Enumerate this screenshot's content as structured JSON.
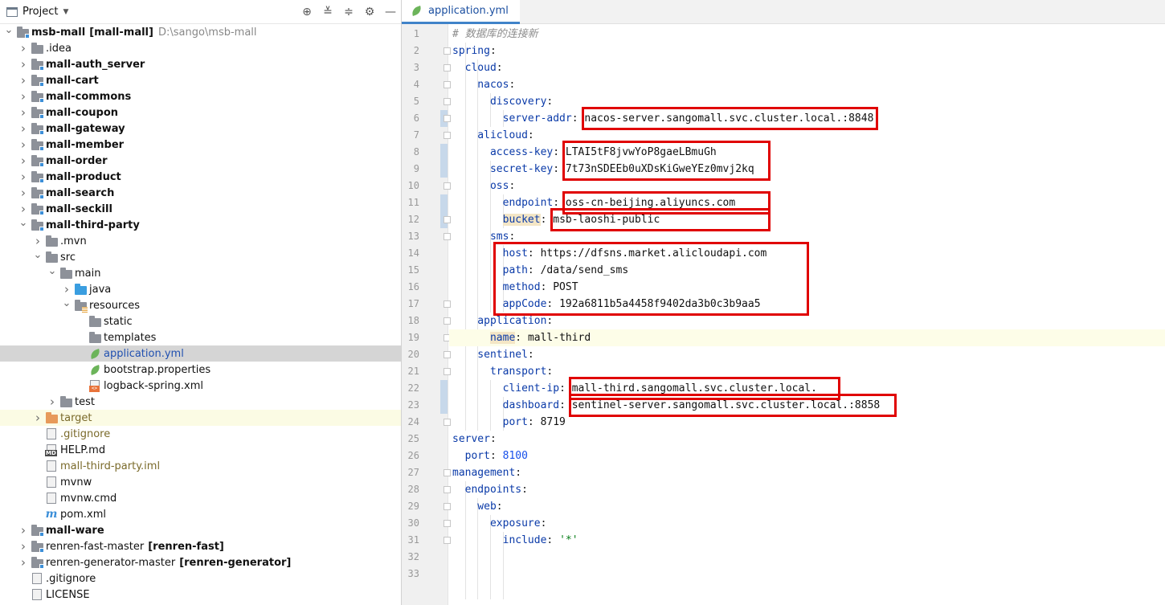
{
  "project_panel": {
    "title": "Project",
    "tools": [
      "locate-icon",
      "expand-all-icon",
      "collapse-all-icon",
      "gear-icon",
      "minimize-icon"
    ],
    "tree": [
      {
        "label": "msb-mall",
        "suffix": "[mall-mall]",
        "path": "D:\\sango\\msb-mall",
        "depth": 0,
        "expanded": true,
        "icon": "module-folder-icon"
      },
      {
        "label": ".idea",
        "depth": 1,
        "expanded": false,
        "icon": "folder-icon"
      },
      {
        "label": "mall-auth_server",
        "depth": 1,
        "expanded": false,
        "icon": "module-folder-icon"
      },
      {
        "label": "mall-cart",
        "depth": 1,
        "expanded": false,
        "icon": "module-folder-icon"
      },
      {
        "label": "mall-commons",
        "depth": 1,
        "expanded": false,
        "icon": "module-folder-icon"
      },
      {
        "label": "mall-coupon",
        "depth": 1,
        "expanded": false,
        "icon": "module-folder-icon"
      },
      {
        "label": "mall-gateway",
        "depth": 1,
        "expanded": false,
        "icon": "module-folder-icon"
      },
      {
        "label": "mall-member",
        "depth": 1,
        "expanded": false,
        "icon": "module-folder-icon"
      },
      {
        "label": "mall-order",
        "depth": 1,
        "expanded": false,
        "icon": "module-folder-icon"
      },
      {
        "label": "mall-product",
        "depth": 1,
        "expanded": false,
        "icon": "module-folder-icon"
      },
      {
        "label": "mall-search",
        "depth": 1,
        "expanded": false,
        "icon": "module-folder-icon"
      },
      {
        "label": "mall-seckill",
        "depth": 1,
        "expanded": false,
        "icon": "module-folder-icon"
      },
      {
        "label": "mall-third-party",
        "depth": 1,
        "expanded": true,
        "icon": "module-folder-icon"
      },
      {
        "label": ".mvn",
        "depth": 2,
        "expanded": false,
        "icon": "folder-icon"
      },
      {
        "label": "src",
        "depth": 2,
        "expanded": true,
        "icon": "folder-icon"
      },
      {
        "label": "main",
        "depth": 3,
        "expanded": true,
        "icon": "folder-icon"
      },
      {
        "label": "java",
        "depth": 4,
        "expanded": false,
        "icon": "source-folder-icon"
      },
      {
        "label": "resources",
        "depth": 4,
        "expanded": true,
        "icon": "resources-folder-icon"
      },
      {
        "label": "static",
        "depth": 5,
        "icon": "folder-icon"
      },
      {
        "label": "templates",
        "depth": 5,
        "icon": "folder-icon"
      },
      {
        "label": "application.yml",
        "depth": 5,
        "icon": "yaml-file-icon",
        "selected": true
      },
      {
        "label": "bootstrap.properties",
        "depth": 5,
        "icon": "properties-file-icon"
      },
      {
        "label": "logback-spring.xml",
        "depth": 5,
        "icon": "xml-file-icon"
      },
      {
        "label": "test",
        "depth": 3,
        "expanded": false,
        "icon": "folder-icon"
      },
      {
        "label": "target",
        "depth": 2,
        "expanded": false,
        "icon": "excluded-folder-icon",
        "excluded": true
      },
      {
        "label": ".gitignore",
        "depth": 2,
        "icon": "gitignore-file-icon"
      },
      {
        "label": "HELP.md",
        "depth": 2,
        "icon": "markdown-file-icon"
      },
      {
        "label": "mall-third-party.iml",
        "depth": 2,
        "icon": "iml-file-icon"
      },
      {
        "label": "mvnw",
        "depth": 2,
        "icon": "script-file-icon"
      },
      {
        "label": "mvnw.cmd",
        "depth": 2,
        "icon": "cmd-file-icon"
      },
      {
        "label": "pom.xml",
        "depth": 2,
        "icon": "maven-pom-icon"
      },
      {
        "label": "mall-ware",
        "depth": 1,
        "expanded": false,
        "icon": "module-folder-icon"
      },
      {
        "label": "renren-fast-master",
        "suffix": "[renren-fast]",
        "depth": 1,
        "expanded": false,
        "icon": "module-folder-icon"
      },
      {
        "label": "renren-generator-master",
        "suffix": "[renren-generator]",
        "depth": 1,
        "expanded": false,
        "icon": "module-folder-icon"
      },
      {
        "label": ".gitignore",
        "depth": 1,
        "icon": "gitignore-file-icon"
      },
      {
        "label": "LICENSE",
        "depth": 1,
        "icon": "text-file-icon"
      }
    ]
  },
  "editor": {
    "tab": {
      "label": "application.yml",
      "icon": "yaml-file-icon"
    },
    "current_line": 19,
    "lines": [
      [
        {
          "t": "# 数据库的连接新",
          "c": "cmt"
        }
      ],
      [
        {
          "t": "spring",
          "c": "k"
        },
        {
          "t": ":",
          "c": "p"
        }
      ],
      [
        {
          "t": "  cloud",
          "c": "k"
        },
        {
          "t": ":",
          "c": "p"
        }
      ],
      [
        {
          "t": "    nacos",
          "c": "k"
        },
        {
          "t": ":",
          "c": "p"
        }
      ],
      [
        {
          "t": "      discovery",
          "c": "k"
        },
        {
          "t": ":",
          "c": "p"
        }
      ],
      [
        {
          "t": "        server-addr",
          "c": "k"
        },
        {
          "t": ": ",
          "c": "p"
        },
        {
          "t": "nacos-server.sangomall.svc.cluster.local.:8848",
          "c": "v"
        }
      ],
      [
        {
          "t": "    alicloud",
          "c": "k"
        },
        {
          "t": ":",
          "c": "p"
        }
      ],
      [
        {
          "t": "      access-key",
          "c": "k"
        },
        {
          "t": ": ",
          "c": "p"
        },
        {
          "t": "LTAI5tF8jvwYoP8gaeLBmuGh",
          "c": "v"
        }
      ],
      [
        {
          "t": "      secret-key",
          "c": "k"
        },
        {
          "t": ": ",
          "c": "p"
        },
        {
          "t": "7t73nSDEEb0uXDsKiGweYEz0mvj2kq",
          "c": "v"
        }
      ],
      [
        {
          "t": "      oss",
          "c": "k"
        },
        {
          "t": ":",
          "c": "p"
        }
      ],
      [
        {
          "t": "        endpoint",
          "c": "k"
        },
        {
          "t": ": ",
          "c": "p"
        },
        {
          "t": "oss-cn-beijing.aliyuncs.com",
          "c": "v"
        }
      ],
      [
        {
          "t": "        ",
          "c": "p"
        },
        {
          "t": "bucket",
          "c": "kh"
        },
        {
          "t": ": ",
          "c": "p"
        },
        {
          "t": "msb-laoshi-public",
          "c": "v"
        }
      ],
      [
        {
          "t": "      sms",
          "c": "k"
        },
        {
          "t": ":",
          "c": "p"
        }
      ],
      [
        {
          "t": "        host",
          "c": "k"
        },
        {
          "t": ": ",
          "c": "p"
        },
        {
          "t": "https://dfsns.market.alicloudapi.com",
          "c": "v"
        }
      ],
      [
        {
          "t": "        path",
          "c": "k"
        },
        {
          "t": ": ",
          "c": "p"
        },
        {
          "t": "/data/send_sms",
          "c": "v"
        }
      ],
      [
        {
          "t": "        method",
          "c": "k"
        },
        {
          "t": ": ",
          "c": "p"
        },
        {
          "t": "POST",
          "c": "v"
        }
      ],
      [
        {
          "t": "        appCode",
          "c": "k"
        },
        {
          "t": ": ",
          "c": "p"
        },
        {
          "t": "192a6811b5a4458f9402da3b0c3b9aa5",
          "c": "v"
        }
      ],
      [
        {
          "t": "    application",
          "c": "k"
        },
        {
          "t": ":",
          "c": "p"
        }
      ],
      [
        {
          "t": "      ",
          "c": "p"
        },
        {
          "t": "name",
          "c": "kh"
        },
        {
          "t": ": ",
          "c": "p"
        },
        {
          "t": "mall-third",
          "c": "v"
        }
      ],
      [
        {
          "t": "    sentinel",
          "c": "k"
        },
        {
          "t": ":",
          "c": "p"
        }
      ],
      [
        {
          "t": "      transport",
          "c": "k"
        },
        {
          "t": ":",
          "c": "p"
        }
      ],
      [
        {
          "t": "        client-ip",
          "c": "k"
        },
        {
          "t": ": ",
          "c": "p"
        },
        {
          "t": "mall-third.sangomall.svc.cluster.local.",
          "c": "v"
        }
      ],
      [
        {
          "t": "        dashboard",
          "c": "k"
        },
        {
          "t": ": ",
          "c": "p"
        },
        {
          "t": "sentinel-server.sangomall.svc.cluster.local.:8858",
          "c": "v"
        }
      ],
      [
        {
          "t": "        port",
          "c": "k"
        },
        {
          "t": ": ",
          "c": "p"
        },
        {
          "t": "8719",
          "c": "v"
        }
      ],
      [
        {
          "t": "server",
          "c": "k"
        },
        {
          "t": ":",
          "c": "p"
        }
      ],
      [
        {
          "t": "  port",
          "c": "k"
        },
        {
          "t": ": ",
          "c": "p"
        },
        {
          "t": "8100",
          "c": "num"
        }
      ],
      [
        {
          "t": "management",
          "c": "k"
        },
        {
          "t": ":",
          "c": "p"
        }
      ],
      [
        {
          "t": "  endpoints",
          "c": "k"
        },
        {
          "t": ":",
          "c": "p"
        }
      ],
      [
        {
          "t": "    web",
          "c": "k"
        },
        {
          "t": ":",
          "c": "p"
        }
      ],
      [
        {
          "t": "      exposure",
          "c": "k"
        },
        {
          "t": ":",
          "c": "p"
        }
      ],
      [
        {
          "t": "        include",
          "c": "k"
        },
        {
          "t": ": ",
          "c": "p"
        },
        {
          "t": "'*'",
          "c": "str"
        }
      ],
      [],
      []
    ],
    "changed_lines": [
      6,
      8,
      9,
      11,
      12,
      22,
      23
    ],
    "fold_lines": [
      2,
      3,
      4,
      5,
      6,
      7,
      10,
      12,
      13,
      17,
      18,
      19,
      20,
      21,
      24,
      27,
      28,
      29,
      30,
      31
    ],
    "highlight_boxes_note_lines": [
      [
        6,
        6
      ],
      [
        8,
        9
      ],
      [
        11,
        11
      ],
      [
        12,
        12
      ],
      [
        14,
        17
      ],
      [
        22,
        22
      ],
      [
        23,
        23
      ]
    ]
  }
}
